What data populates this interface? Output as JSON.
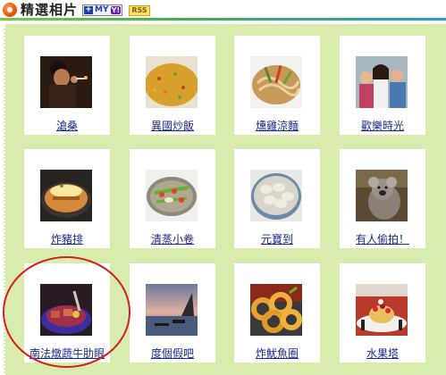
{
  "header": {
    "title": "精選相片",
    "my_badge": "MY",
    "rss_badge": "RSS"
  },
  "colors": {
    "panel_bg": "#d8ecad",
    "link": "#1a2a8a",
    "highlight": "#d11f1f"
  },
  "photos": [
    {
      "label": "滄桑",
      "image": "elderly-man-smoking-photo"
    },
    {
      "label": "異國炒飯",
      "image": "fried-rice-photo"
    },
    {
      "label": "燻雞涼麵",
      "image": "chicken-cold-noodle-photo"
    },
    {
      "label": "歡樂時光",
      "image": "happy-friends-photo"
    },
    {
      "label": "炸豬排",
      "image": "pork-cutlet-photo"
    },
    {
      "label": "清蒸小卷",
      "image": "steamed-squid-photo"
    },
    {
      "label": "元寶到",
      "image": "dumplings-photo"
    },
    {
      "label": "有人偷拍！",
      "image": "koala-photo"
    },
    {
      "label": "南法燉蔬牛肋眼",
      "image": "beef-ribeye-stew-photo"
    },
    {
      "label": "度個假吧",
      "image": "beach-vacation-photo"
    },
    {
      "label": "炸魷魚圈",
      "image": "fried-squid-rings-photo"
    },
    {
      "label": "水果塔",
      "image": "fruit-tart-photo"
    }
  ]
}
